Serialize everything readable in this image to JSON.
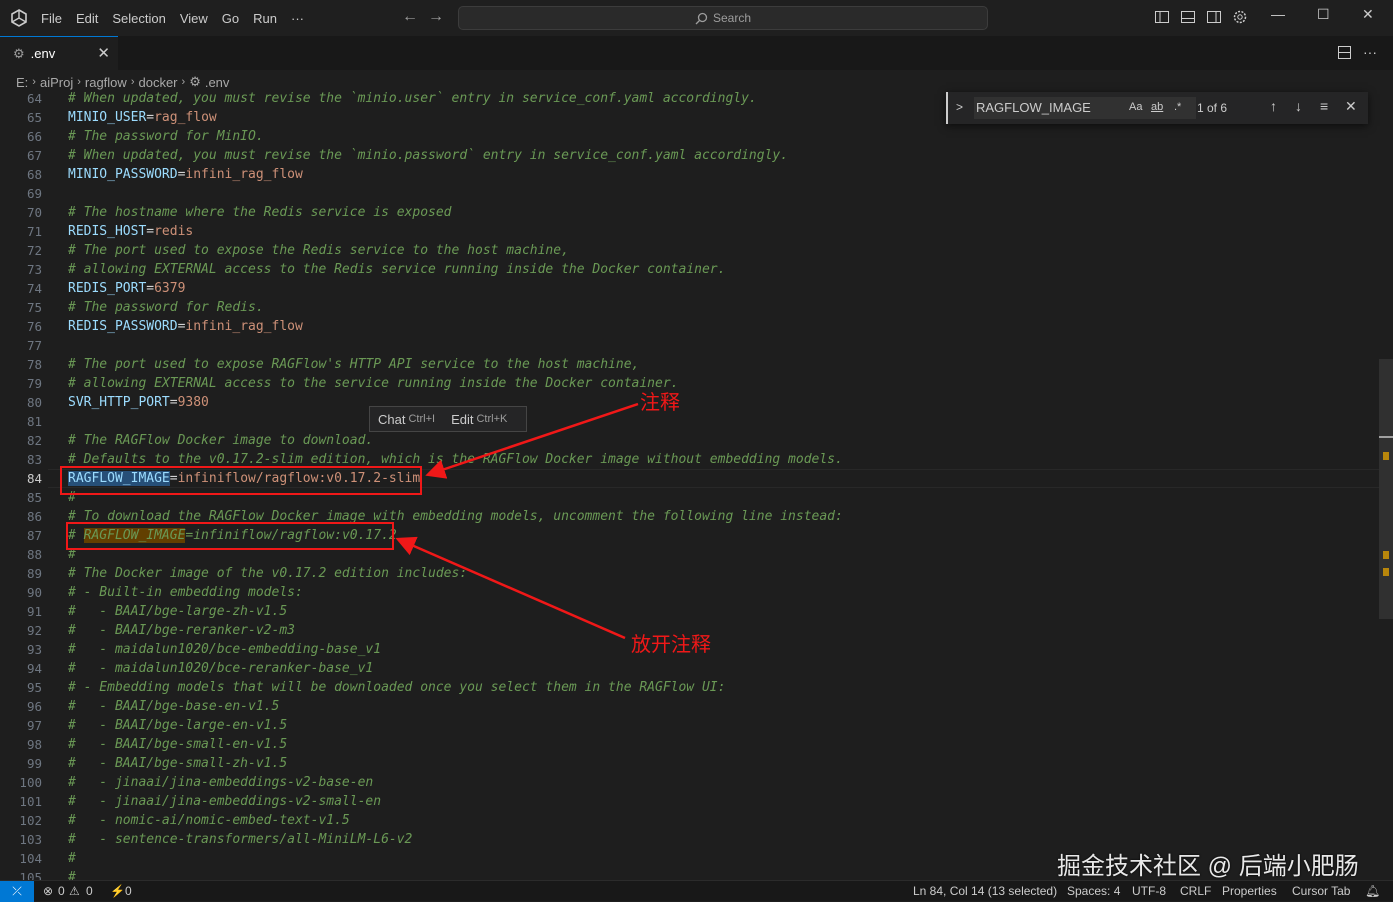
{
  "menu": [
    "File",
    "Edit",
    "Selection",
    "View",
    "Go",
    "Run",
    "···"
  ],
  "search_placeholder": "Search",
  "tab": {
    "name": ".env"
  },
  "breadcrumb": [
    "E:",
    "aiProj",
    "ragflow",
    "docker",
    ".env"
  ],
  "find": {
    "query": "RAGFLOW_IMAGE",
    "count": "1 of 6",
    "opt_case": "Aa",
    "opt_word": "ab",
    "opt_regex": ".*"
  },
  "popup": {
    "chat": "Chat",
    "chat_kb": "Ctrl+I",
    "edit": "Edit",
    "edit_kb": "Ctrl+K"
  },
  "annotations": {
    "comment": "注释",
    "uncomment": "放开注释"
  },
  "watermark": "掘金技术社区 @ 后端小肥肠",
  "status": {
    "errors": "0",
    "warnings": "0",
    "ports": "0",
    "position": "Ln 84, Col 14 (13 selected)",
    "spaces": "Spaces: 4",
    "encoding": "UTF-8",
    "eol": "CRLF",
    "language": "Properties",
    "cursor_tab": "Cursor Tab"
  },
  "current_line": 84,
  "lines": [
    {
      "n": "64",
      "t": "c",
      "text": "# When updated, you must revise the `minio.user` entry in service_conf.yaml accordingly."
    },
    {
      "n": "65",
      "t": "kv",
      "key": "MINIO_USER",
      "value": "rag_flow"
    },
    {
      "n": "66",
      "t": "c",
      "text": "# The password for MinIO."
    },
    {
      "n": "67",
      "t": "c",
      "text": "# When updated, you must revise the `minio.password` entry in service_conf.yaml accordingly."
    },
    {
      "n": "68",
      "t": "kv",
      "key": "MINIO_PASSWORD",
      "value": "infini_rag_flow"
    },
    {
      "n": "69",
      "t": "e"
    },
    {
      "n": "70",
      "t": "c",
      "text": "# The hostname where the Redis service is exposed"
    },
    {
      "n": "71",
      "t": "kv",
      "key": "REDIS_HOST",
      "value": "redis"
    },
    {
      "n": "72",
      "t": "c",
      "text": "# The port used to expose the Redis service to the host machine,"
    },
    {
      "n": "73",
      "t": "c",
      "text": "# allowing EXTERNAL access to the Redis service running inside the Docker container."
    },
    {
      "n": "74",
      "t": "kv",
      "key": "REDIS_PORT",
      "value": "6379"
    },
    {
      "n": "75",
      "t": "c",
      "text": "# The password for Redis."
    },
    {
      "n": "76",
      "t": "kv",
      "key": "REDIS_PASSWORD",
      "value": "infini_rag_flow"
    },
    {
      "n": "77",
      "t": "e"
    },
    {
      "n": "78",
      "t": "c",
      "text": "# The port used to expose RAGFlow's HTTP API service to the host machine,"
    },
    {
      "n": "79",
      "t": "c",
      "text": "# allowing EXTERNAL access to the service running inside the Docker container."
    },
    {
      "n": "80",
      "t": "kv",
      "key": "SVR_HTTP_PORT",
      "value": "9380"
    },
    {
      "n": "81",
      "t": "e"
    },
    {
      "n": "82",
      "t": "c",
      "text": "# The RAGFlow Docker image to download."
    },
    {
      "n": "83",
      "t": "c",
      "text": "# Defaults to the v0.17.2-slim edition, which is the RAGFlow Docker image without embedding models."
    },
    {
      "n": "84",
      "t": "kv",
      "key": "RAGFLOW_IMAGE",
      "value": "infiniflow/ragflow:v0.17.2-slim",
      "sel": true
    },
    {
      "n": "85",
      "t": "c",
      "text": "#"
    },
    {
      "n": "86",
      "t": "c",
      "text": "# To download the RAGFlow Docker image with embedding models, uncomment the following line instead:"
    },
    {
      "n": "87",
      "t": "ck",
      "pre": "# ",
      "key": "RAGFLOW_IMAGE",
      "post": "=infiniflow/ragflow:v0.17.2"
    },
    {
      "n": "88",
      "t": "c",
      "text": "#"
    },
    {
      "n": "89",
      "t": "c",
      "text": "# The Docker image of the v0.17.2 edition includes:"
    },
    {
      "n": "90",
      "t": "c",
      "text": "# - Built-in embedding models:"
    },
    {
      "n": "91",
      "t": "c",
      "text": "#   - BAAI/bge-large-zh-v1.5"
    },
    {
      "n": "92",
      "t": "c",
      "text": "#   - BAAI/bge-reranker-v2-m3"
    },
    {
      "n": "93",
      "t": "c",
      "text": "#   - maidalun1020/bce-embedding-base_v1"
    },
    {
      "n": "94",
      "t": "c",
      "text": "#   - maidalun1020/bce-reranker-base_v1"
    },
    {
      "n": "95",
      "t": "c",
      "text": "# - Embedding models that will be downloaded once you select them in the RAGFlow UI:"
    },
    {
      "n": "96",
      "t": "c",
      "text": "#   - BAAI/bge-base-en-v1.5"
    },
    {
      "n": "97",
      "t": "c",
      "text": "#   - BAAI/bge-large-en-v1.5"
    },
    {
      "n": "98",
      "t": "c",
      "text": "#   - BAAI/bge-small-en-v1.5"
    },
    {
      "n": "99",
      "t": "c",
      "text": "#   - BAAI/bge-small-zh-v1.5"
    },
    {
      "n": "100",
      "t": "c",
      "text": "#   - jinaai/jina-embeddings-v2-base-en"
    },
    {
      "n": "101",
      "t": "c",
      "text": "#   - jinaai/jina-embeddings-v2-small-en"
    },
    {
      "n": "102",
      "t": "c",
      "text": "#   - nomic-ai/nomic-embed-text-v1.5"
    },
    {
      "n": "103",
      "t": "c",
      "text": "#   - sentence-transformers/all-MiniLM-L6-v2"
    },
    {
      "n": "104",
      "t": "c",
      "text": "#"
    },
    {
      "n": "105",
      "t": "c",
      "text": "#"
    }
  ]
}
